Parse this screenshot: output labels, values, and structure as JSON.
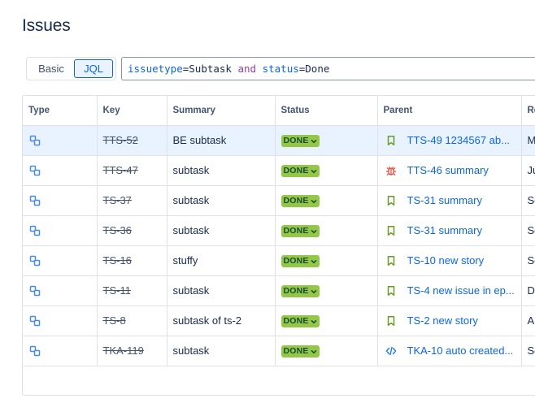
{
  "page": {
    "title": "Issues"
  },
  "search_mode": {
    "basic_label": "Basic",
    "jql_label": "JQL",
    "selected": "JQL"
  },
  "jql": {
    "tokens": [
      {
        "text": "issuetype",
        "kind": "field"
      },
      {
        "text": "=",
        "kind": "op"
      },
      {
        "text": "Subtask",
        "kind": "val"
      },
      {
        "text": " and ",
        "kind": "kw"
      },
      {
        "text": "status",
        "kind": "field"
      },
      {
        "text": "=",
        "kind": "op"
      },
      {
        "text": "Done",
        "kind": "val"
      }
    ]
  },
  "table": {
    "columns": [
      "Type",
      "Key",
      "Summary",
      "Status",
      "Parent",
      "Re"
    ],
    "rows": [
      {
        "key": "TTS-52",
        "summary": "BE subtask",
        "status": "DONE",
        "parent_icon": "story-bookmark-icon",
        "parent": "TTS-49 1234567 ab...",
        "extra": "M",
        "selected": true
      },
      {
        "key": "TTS-47",
        "summary": "subtask",
        "status": "DONE",
        "parent_icon": "bug-icon",
        "parent": "TTS-46 summary",
        "extra": "Ju",
        "selected": false
      },
      {
        "key": "TS-37",
        "summary": "subtask",
        "status": "DONE",
        "parent_icon": "story-bookmark-icon",
        "parent": "TS-31 summary",
        "extra": "Se",
        "selected": false
      },
      {
        "key": "TS-36",
        "summary": "subtask",
        "status": "DONE",
        "parent_icon": "story-bookmark-icon",
        "parent": "TS-31 summary",
        "extra": "Se",
        "selected": false
      },
      {
        "key": "TS-16",
        "summary": "stuffy",
        "status": "DONE",
        "parent_icon": "story-bookmark-icon",
        "parent": "TS-10 new story",
        "extra": "Se",
        "selected": false
      },
      {
        "key": "TS-11",
        "summary": "subtask",
        "status": "DONE",
        "parent_icon": "story-bookmark-icon",
        "parent": "TS-4 new issue in ep...",
        "extra": "De",
        "selected": false
      },
      {
        "key": "TS-8",
        "summary": "subtask of ts-2",
        "status": "DONE",
        "parent_icon": "story-bookmark-icon",
        "parent": "TS-2 new story",
        "extra": "Au",
        "selected": false
      },
      {
        "key": "TKA-119",
        "summary": "subtask",
        "status": "DONE",
        "parent_icon": "code-icon",
        "parent": "TKA-10 auto created...",
        "extra": "Se",
        "selected": false
      }
    ]
  },
  "colors": {
    "subtask_icon": "#4688ec",
    "story_icon": "#6a9a23",
    "bug_icon": "#e34935",
    "code_icon": "#1d7afc",
    "done_lozenge": "#94c748",
    "link": "#0c66e4",
    "selected_row": "#e9f2ff"
  }
}
